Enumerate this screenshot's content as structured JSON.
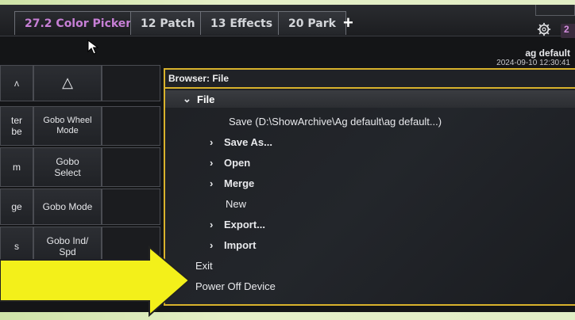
{
  "tabs": [
    {
      "label": "27.2 Color Picker",
      "active": true
    },
    {
      "label": "12 Patch",
      "active": false
    },
    {
      "label": "13 Effects",
      "active": false
    },
    {
      "label": "20 Park",
      "active": false
    }
  ],
  "add_tab": "+",
  "corner_tag": "2",
  "header": {
    "show_name": "ag default",
    "datetime": "2024-09-10 12:30:41"
  },
  "grid": {
    "col1": [
      "ter\nbe",
      "m",
      "ge",
      "s"
    ],
    "col2_top_icon": "△",
    "col2": [
      "Gobo Wheel\nMode",
      "Gobo\nSelect",
      "Gobo Mode",
      "Gobo Ind/\nSpd"
    ],
    "partial_top": "ʌ"
  },
  "browser": {
    "title": "Browser: File",
    "folder": "File",
    "items": [
      {
        "label": "Save (D:\\ShowArchive\\Ag default\\ag default...)",
        "chevron": false,
        "bold": false
      },
      {
        "label": "Save As...",
        "chevron": true,
        "bold": true
      },
      {
        "label": "Open",
        "chevron": true,
        "bold": true
      },
      {
        "label": "Merge",
        "chevron": true,
        "bold": true
      },
      {
        "label": "New",
        "chevron": false,
        "bold": false
      },
      {
        "label": "Export...",
        "chevron": true,
        "bold": true
      },
      {
        "label": "Import",
        "chevron": true,
        "bold": true
      }
    ],
    "root_items": [
      {
        "label": "Exit"
      },
      {
        "label": "Power Off Device"
      }
    ]
  },
  "colors": {
    "accent_tab": "#c77fd6",
    "browser_border": "#d8b22c",
    "arrow": "#f3f01a"
  }
}
